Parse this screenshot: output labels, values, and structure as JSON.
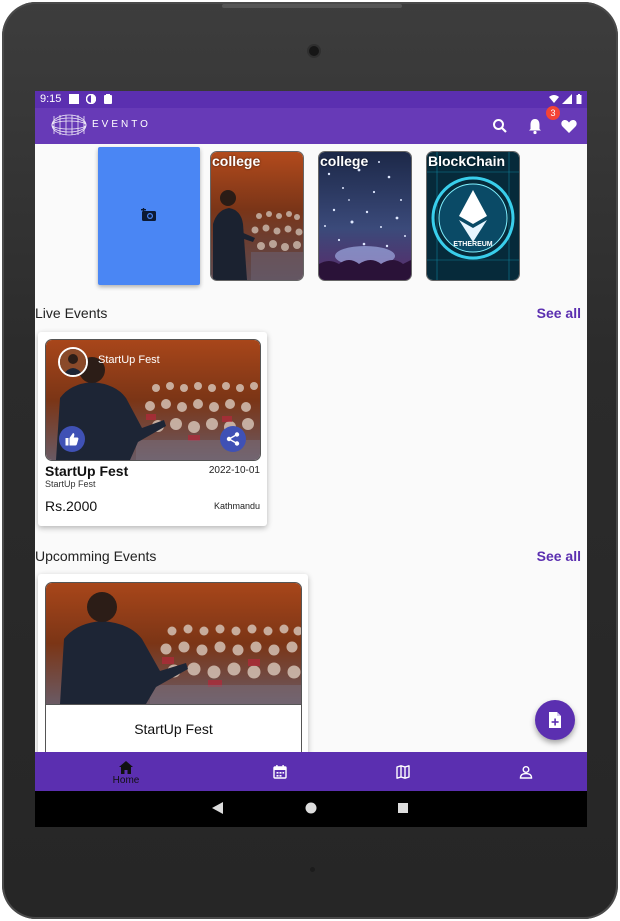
{
  "status": {
    "time": "9:15"
  },
  "app": {
    "name": "EVENTO",
    "notification_count": "3"
  },
  "stories": [
    {
      "label": "college"
    },
    {
      "label": "college"
    },
    {
      "label": "BlockChain",
      "image_text": "ETHEREUM"
    }
  ],
  "live": {
    "section_title": "Live Events",
    "see_all": "See all",
    "card": {
      "overlay_name": "StartUp Fest",
      "title": "StartUp Fest",
      "subtitle": "StartUp Fest",
      "date": "2022-10-01",
      "price": "Rs.2000",
      "location": "Kathmandu"
    }
  },
  "upcoming": {
    "section_title": "Upcomming Events",
    "see_all": "See all",
    "card": {
      "title": "StartUp Fest"
    }
  },
  "bottom_nav": [
    {
      "label": "Home",
      "icon": "home-icon",
      "active": true
    },
    {
      "label": "",
      "icon": "calendar-icon"
    },
    {
      "label": "",
      "icon": "map-icon"
    },
    {
      "label": "",
      "icon": "person-icon"
    }
  ],
  "colors": {
    "primary": "#673ab7",
    "primary_dark": "#5b2fb0",
    "add_story": "#4a86f4",
    "badge": "#f44336",
    "action_button": "#3f51b5"
  }
}
